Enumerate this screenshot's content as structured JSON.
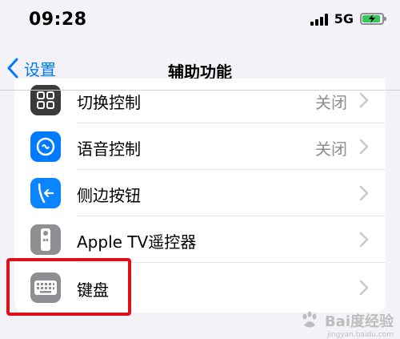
{
  "status_bar": {
    "time": "09:28",
    "network": "5G",
    "battery_level": 0.8,
    "battery_color": "#34c759"
  },
  "nav": {
    "back_label": "设置",
    "title": "辅助功能",
    "accent": "#007aff"
  },
  "rows": [
    {
      "label": "切换控制",
      "value": "关闭",
      "icon": "switch-control-icon",
      "icon_bg": "#3a3a3c"
    },
    {
      "label": "语音控制",
      "value": "关闭",
      "icon": "voice-control-icon",
      "icon_bg": "#007aff"
    },
    {
      "label": "侧边按钮",
      "value": "",
      "icon": "side-button-icon",
      "icon_bg": "#0a84ff"
    },
    {
      "label": "Apple TV遥控器",
      "value": "",
      "icon": "apple-tv-remote-icon",
      "icon_bg": "#8e8e93"
    },
    {
      "label": "键盘",
      "value": "",
      "icon": "keyboard-icon",
      "icon_bg": "#8e8e93"
    }
  ],
  "highlight_color": "#e0101a",
  "watermark": {
    "text": "Bai度经验",
    "sub": "jingyan.baidu.com"
  }
}
